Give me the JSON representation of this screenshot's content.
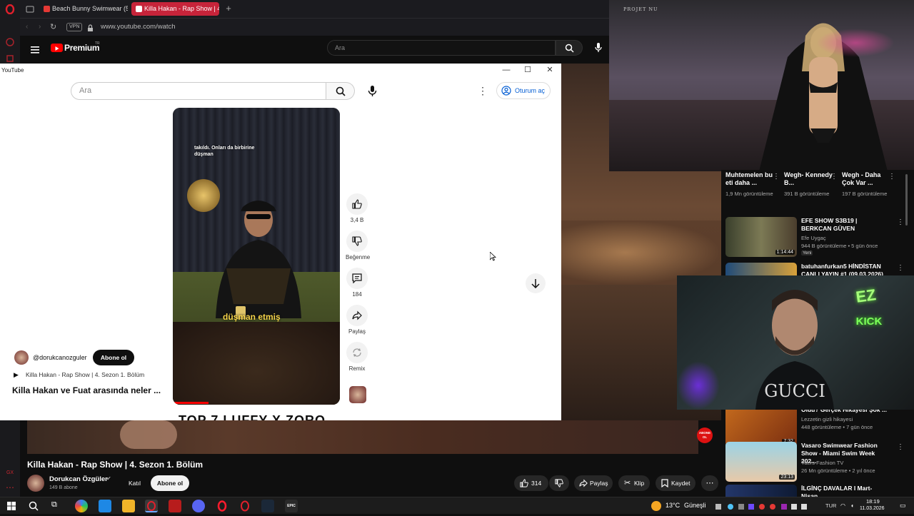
{
  "browser": {
    "tabs": [
      {
        "label": "Beach Bunny Swimwear (5"
      },
      {
        "label": "Killa Hakan - Rap Show | 4"
      }
    ],
    "vpn_label": "VPN",
    "url": "www.youtube.com/watch",
    "yt_brand": "Premium",
    "yt_region": "TR",
    "search_placeholder": "Ara"
  },
  "popup": {
    "window_title": "YouTube",
    "search_placeholder": "Ara",
    "signin_label": "Oturum aç",
    "short": {
      "caption_top": "takıldı. Onları da birbirine düşman",
      "caption_bottom": "düşman etmiş",
      "channel_handle": "@dorukcanozguler",
      "subscribe_label": "Abone ol",
      "playlist_label": "Killa Hakan - Rap Show | 4. Sezon 1. Bölüm",
      "title": "Killa Hakan ve Fuat arasında neler ...",
      "next_peek": "TOP 7 LUFFY X ZORO"
    },
    "actions": [
      {
        "name": "like",
        "label": "3,4 B"
      },
      {
        "name": "dislike",
        "label": "Beğenme"
      },
      {
        "name": "comments",
        "label": "184"
      },
      {
        "name": "share",
        "label": "Paylaş"
      },
      {
        "name": "remix",
        "label": "Remix"
      }
    ]
  },
  "stream_overlay": {
    "brand_small": "PROJET NU",
    "ez_text": "EZ",
    "kick_text": "KICK",
    "abone_text": "ABONE OL"
  },
  "recommendations": {
    "top_row": [
      {
        "title": "Muhtemelen bu eti daha ...",
        "meta": "1,9 Mn görüntüleme"
      },
      {
        "title": "Wegh- Kennedy B...",
        "meta": "391 B görüntüleme"
      },
      {
        "title": "Wegh - Daha Çok Var ...",
        "meta": "197 B görüntüleme"
      }
    ],
    "videos": [
      {
        "title": "EFE SHOW S3B19 | BERKCAN GÜVEN",
        "channel": "Efe Uygaç",
        "meta": "944 B görüntüleme • 5 gün önce",
        "badge": "Yeni",
        "duration": "1:14:44"
      },
      {
        "title": "batuhanfurkan5 HİNDİSTAN CANLI YAYIN #1 (09.03.2026)",
        "channel": "",
        "meta": "",
        "badge": "",
        "duration": ""
      },
      {
        "title": "Oldu? Gerçek Hikayesi Şok ...",
        "channel": "Lezzetin gizli hikayesi",
        "meta": "448 görüntüleme • 7 gün önce",
        "badge": "",
        "duration": "7:32"
      },
      {
        "title": "Vasaro Swimwear Fashion Show - Miami Swim Week 202...",
        "channel": "Yaers Fashion TV",
        "meta": "26 Mn görüntüleme • 2 yıl önce",
        "badge": "",
        "duration": "23:13"
      },
      {
        "title": "İLGİNÇ DAVALAR I Mart-Nisan",
        "channel": "",
        "meta": "",
        "badge": "",
        "duration": ""
      }
    ]
  },
  "main_video": {
    "title": "Killa Hakan - Rap Show | 4. Sezon 1. Bölüm",
    "channel": "Dorukcan Özgüler",
    "subscribers": "149 B abone",
    "join_label": "Katıl",
    "subscribe_label": "Abone ol",
    "likes": "314",
    "share_label": "Paylaş",
    "clip_label": "Klip",
    "save_label": "Kaydet"
  },
  "taskbar": {
    "temperature": "13°C",
    "weather": "Güneşli",
    "lang": "TUR",
    "time": "18:19",
    "date": "11.03.2026"
  },
  "colors": {
    "yt_red": "#ff0000",
    "tab_active": "#c7243a",
    "link_blue": "#065fd4"
  }
}
